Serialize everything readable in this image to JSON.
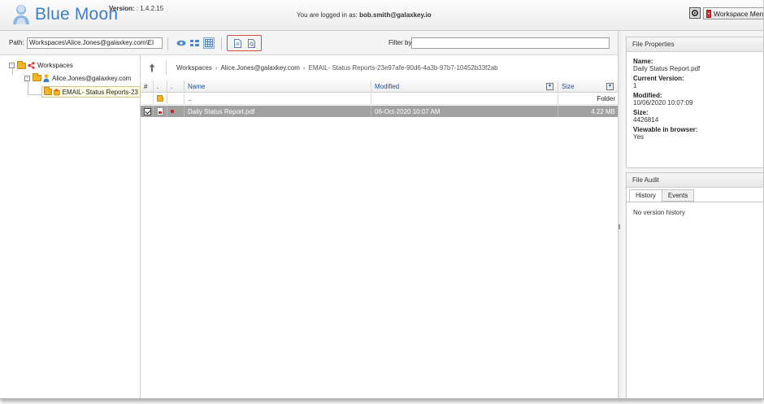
{
  "header": {
    "app_name": "Blue Moon",
    "version_label": "Version:",
    "version_value": ": 1.4.2.15",
    "logged_in_prefix": "You are logged in as:",
    "logged_in_user": "bob.smith@galaxkey.io",
    "menu_button_label": "Workspace Menu"
  },
  "toolbar": {
    "path_label": "Path:",
    "path_value": "Workspaces\\Alice.Jones@galaxkey.com\\EI",
    "filter_label": "Filter by:",
    "filter_value": "",
    "icons": [
      "eye-icon",
      "list-view-icon",
      "grid-view-icon",
      "file-new-icon",
      "file-search-icon"
    ]
  },
  "tree": {
    "root_label": "Workspaces",
    "user_label": "Alice.Jones@galaxkey.com",
    "folder_label": "EMAIL- Status Reports-23"
  },
  "breadcrumb": {
    "items": [
      "Workspaces",
      "Alice.Jones@galaxkey.com"
    ],
    "current": "EMAIL- Status Reports-23e97afe-90d6-4a3b-97b7-10452b33f2ab",
    "separator": "›"
  },
  "grid": {
    "headers": {
      "num": "#",
      "dot1": ".",
      "dot2": ".",
      "name": "Name",
      "modified": "Modified",
      "size": "Size"
    },
    "folder_row": {
      "name": "..",
      "size": "Folder"
    },
    "file_row": {
      "name": "Daily Status Report.pdf",
      "modified": "06-Oct-2020 10:07 AM",
      "size": "4.22 MB",
      "checked": true
    }
  },
  "properties": {
    "title": "File Properties",
    "name_label": "Name:",
    "name_value": "Daily Status Report.pdf",
    "version_label": "Current Version:",
    "version_value": "1",
    "modified_label": "Modified:",
    "modified_value": "10/06/2020 10:07:09",
    "size_label": "Size:",
    "size_value": "4426814",
    "viewable_label": "Viewable in browser:",
    "viewable_value": "Yes"
  },
  "audit": {
    "title": "File Audit",
    "tabs": [
      "History",
      "Events"
    ],
    "active_tab": "History",
    "empty_text": "No version history"
  },
  "colors": {
    "brand_blue": "#3d7ec9",
    "selected_row": "#a1a1a1",
    "highlight_red": "#d84b3a",
    "folder_yellow": "#f0b428"
  }
}
